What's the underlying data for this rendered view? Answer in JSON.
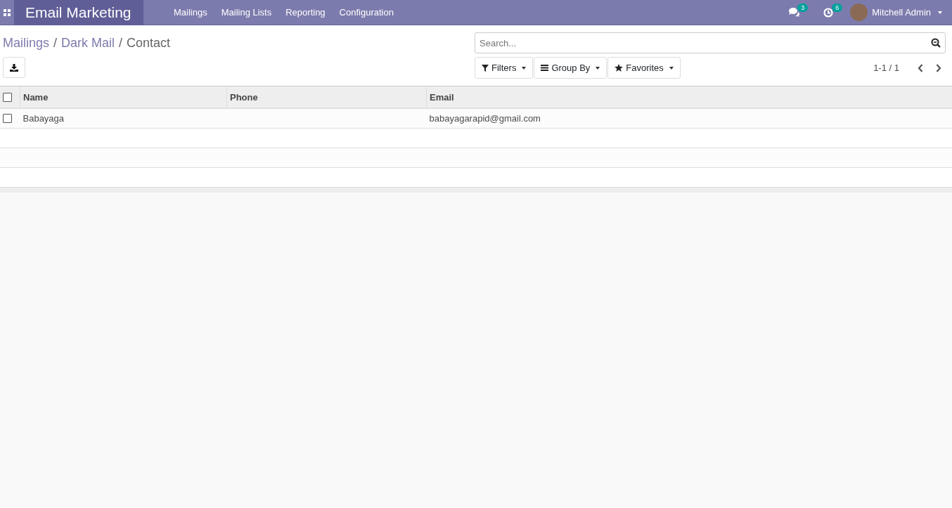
{
  "app_name": "Email Marketing",
  "menu": [
    "Mailings",
    "Mailing Lists",
    "Reporting",
    "Configuration"
  ],
  "systray": {
    "messages_count": "3",
    "activities_count": "6",
    "user": "Mitchell Admin"
  },
  "breadcrumbs": [
    {
      "label": "Mailings",
      "link": true
    },
    {
      "separator": "/",
      "label": "Dark Mail",
      "link": true
    },
    {
      "separator": "/",
      "label": "Contact",
      "link": false
    }
  ],
  "search": {
    "placeholder": "Search..."
  },
  "search_buttons": [
    {
      "kind": "filter",
      "label": "Filters"
    },
    {
      "kind": "group",
      "label": "Group By"
    },
    {
      "kind": "star",
      "label": "Favorites"
    }
  ],
  "pager": "1-1 / 1",
  "table": {
    "select_all": {
      "checked": false
    },
    "columns": [
      "Name",
      "Phone",
      "Email"
    ],
    "rows": [
      {
        "checked": false,
        "name": "Babayaga",
        "email": "babayagarapid@gmail.com"
      }
    ]
  }
}
